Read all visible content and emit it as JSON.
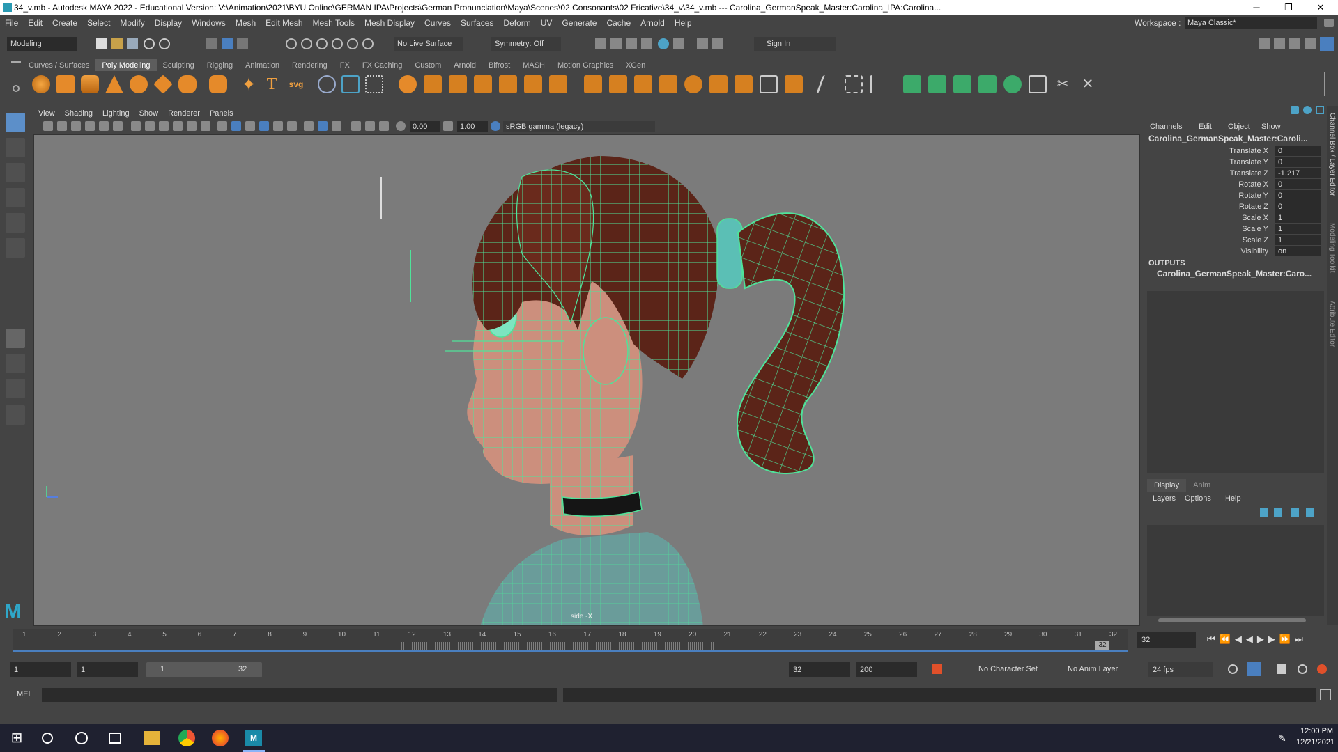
{
  "window": {
    "title": "34_v.mb - Autodesk MAYA 2022 - Educational Version: V:\\Animation\\2021\\BYU Online\\GERMAN IPA\\Projects\\German Pronunciation\\Maya\\Scenes\\02 Consonants\\02 Fricative\\34_v\\34_v.mb  ---  Carolina_GermanSpeak_Master:Carolina_IPA:Carolina...",
    "minimize": "─",
    "maximize": "❐",
    "close": "✕"
  },
  "menubar": {
    "items": [
      "File",
      "Edit",
      "Create",
      "Select",
      "Modify",
      "Display",
      "Windows",
      "Mesh",
      "Edit Mesh",
      "Mesh Tools",
      "Mesh Display",
      "Curves",
      "Surfaces",
      "Deform",
      "UV",
      "Generate",
      "Cache",
      "Arnold",
      "Help"
    ],
    "workspace_label": "Workspace :",
    "workspace_value": "Maya Classic*"
  },
  "statusline": {
    "mode": "Modeling",
    "live_surface": "No Live Surface",
    "symmetry": "Symmetry: Off",
    "sign_in": "Sign In"
  },
  "shelf": {
    "tabs": [
      "Curves / Surfaces",
      "Poly Modeling",
      "Sculpting",
      "Rigging",
      "Animation",
      "Rendering",
      "FX",
      "FX Caching",
      "Custom",
      "Arnold",
      "Bifrost",
      "MASH",
      "Motion Graphics",
      "XGen"
    ],
    "active_tab": "Poly Modeling",
    "text_icon": "T",
    "svg_icon": "svg"
  },
  "viewport": {
    "menus": [
      "View",
      "Shading",
      "Lighting",
      "Show",
      "Renderer",
      "Panels"
    ],
    "exposure": "0.00",
    "gamma": "1.00",
    "color_space": "sRGB gamma (legacy)",
    "camera_label": "side -X"
  },
  "channel_box": {
    "menus": [
      "Channels",
      "Edit",
      "Object",
      "Show"
    ],
    "object_name": "Carolina_GermanSpeak_Master:Caroli...",
    "attributes": [
      {
        "label": "Translate X",
        "value": "0"
      },
      {
        "label": "Translate Y",
        "value": "0"
      },
      {
        "label": "Translate Z",
        "value": "-1.217"
      },
      {
        "label": "Rotate X",
        "value": "0"
      },
      {
        "label": "Rotate Y",
        "value": "0"
      },
      {
        "label": "Rotate Z",
        "value": "0"
      },
      {
        "label": "Scale X",
        "value": "1"
      },
      {
        "label": "Scale Y",
        "value": "1"
      },
      {
        "label": "Scale Z",
        "value": "1"
      },
      {
        "label": "Visibility",
        "value": "on"
      }
    ],
    "outputs_label": "OUTPUTS",
    "output_item": "Carolina_GermanSpeak_Master:Caro..."
  },
  "layer_editor": {
    "tabs": [
      "Display",
      "Anim"
    ],
    "menus": [
      "Layers",
      "Options",
      "Help"
    ]
  },
  "side_tabs": [
    "Channel Box / Layer Editor",
    "Modeling Toolkit",
    "Attribute Editor"
  ],
  "timeline": {
    "ticks": [
      "1",
      "2",
      "3",
      "4",
      "5",
      "6",
      "7",
      "8",
      "9",
      "10",
      "11",
      "12",
      "13",
      "14",
      "15",
      "16",
      "17",
      "18",
      "19",
      "20",
      "21",
      "22",
      "23",
      "24",
      "25",
      "26",
      "27",
      "28",
      "29",
      "30",
      "31",
      "32"
    ],
    "current_frame": "32",
    "current_marker": "32"
  },
  "range": {
    "start": "1",
    "playback_start": "1",
    "slider_start": "1",
    "slider_end": "32",
    "playback_end": "32",
    "end": "200",
    "character_set": "No Character Set",
    "anim_layer": "No Anim Layer",
    "fps": "24 fps"
  },
  "command_line": {
    "label": "MEL"
  },
  "taskbar": {
    "time": "12:00 PM",
    "date": "12/21/2021"
  },
  "colors": {
    "wire": "#4fe39a",
    "hair": "#5b2418",
    "skin": "#cc8f7d",
    "shirt": "#6a9c9a",
    "viewport_bg": "#7b7b7b"
  }
}
